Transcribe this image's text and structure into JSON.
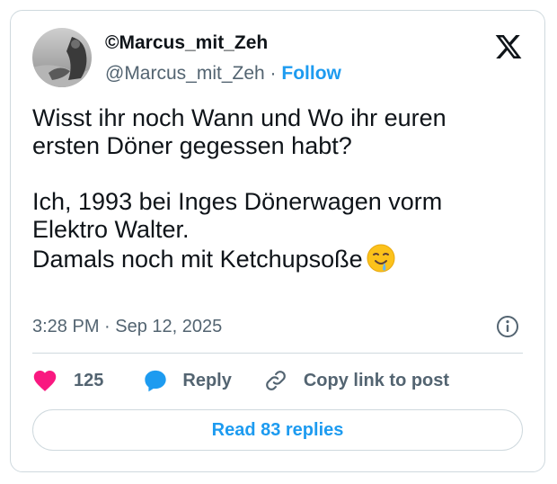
{
  "author": {
    "display_name": "©Marcus_mit_Zeh",
    "handle": "@Marcus_mit_Zeh",
    "separator": "·",
    "follow_label": "Follow",
    "avatar_icon": "avatar-photo"
  },
  "brand": {
    "logo_icon": "x-logo-icon"
  },
  "tweet": {
    "lines_1": [
      "Wisst ihr noch Wann und Wo ihr euren",
      "ersten Döner gegessen habt?"
    ],
    "line_3": "Ich, 1993 bei Inges Dönerwagen vorm",
    "line_4": "Elektro Walter.",
    "line_5": "Damals noch mit Ketchupsoße",
    "emoji_icon": "drooling-face-emoji"
  },
  "meta": {
    "timestamp": "3:28 PM · Sep 12, 2025",
    "info_icon": "info-icon"
  },
  "actions": {
    "like_count": "125",
    "reply_label": "Reply",
    "copy_label": "Copy link to post"
  },
  "read_replies_label": "Read 83 replies",
  "colors": {
    "accent": "#1d9bf0",
    "like": "#f91880",
    "text": "#0f1419",
    "muted": "#536471",
    "border": "#cfd9de"
  }
}
